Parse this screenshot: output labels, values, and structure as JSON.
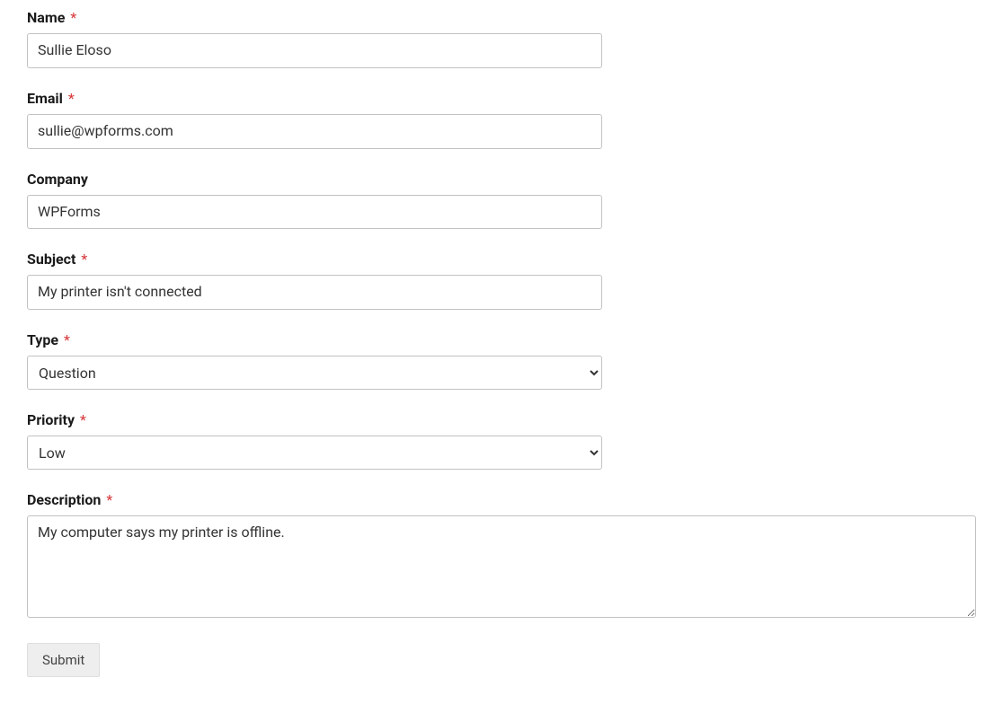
{
  "fields": {
    "name": {
      "label": "Name",
      "required": true,
      "value": "Sullie Eloso"
    },
    "email": {
      "label": "Email",
      "required": true,
      "value": "sullie@wpforms.com"
    },
    "company": {
      "label": "Company",
      "required": false,
      "value": "WPForms"
    },
    "subject": {
      "label": "Subject",
      "required": true,
      "value": "My printer isn't connected"
    },
    "type": {
      "label": "Type",
      "required": true,
      "value": "Question"
    },
    "priority": {
      "label": "Priority",
      "required": true,
      "value": "Low"
    },
    "description": {
      "label": "Description",
      "required": true,
      "value": "My computer says my printer is offline."
    }
  },
  "required_marker": "*",
  "submit_label": "Submit"
}
